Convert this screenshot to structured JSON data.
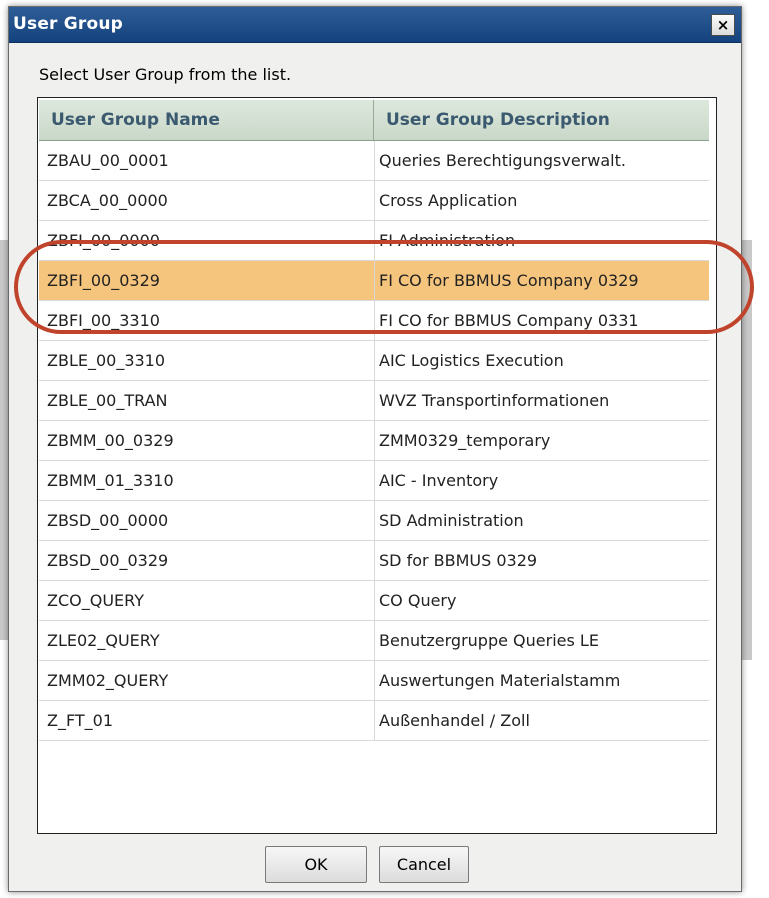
{
  "dialog": {
    "title": "User Group",
    "close_glyph": "×",
    "instruction": "Select User Group from the list."
  },
  "grid": {
    "columns": [
      "User Group Name",
      "User Group Description"
    ],
    "rows": [
      {
        "name": "ZBAU_00_0001",
        "description": "Queries Berechtigungsverwalt."
      },
      {
        "name": "ZBCA_00_0000",
        "description": "Cross Application"
      },
      {
        "name": "ZBFI_00_0000",
        "description": "FI Administration"
      },
      {
        "name": "ZBFI_00_0329",
        "description": "FI CO  for BBMUS  Company 0329"
      },
      {
        "name": "ZBFI_00_3310",
        "description": "FI CO  for BBMUS  Company 0331"
      },
      {
        "name": "ZBLE_00_3310",
        "description": "AIC Logistics Execution"
      },
      {
        "name": "ZBLE_00_TRAN",
        "description": "WVZ Transportinformationen"
      },
      {
        "name": "ZBMM_00_0329",
        "description": "ZMM0329_temporary"
      },
      {
        "name": "ZBMM_01_3310",
        "description": "AIC - Inventory"
      },
      {
        "name": "ZBSD_00_0000",
        "description": "SD Administration"
      },
      {
        "name": "ZBSD_00_0329",
        "description": "SD for BBMUS 0329"
      },
      {
        "name": "ZCO_QUERY",
        "description": "CO Query"
      },
      {
        "name": "ZLE02_QUERY",
        "description": "Benutzergruppe Queries LE"
      },
      {
        "name": "ZMM02_QUERY",
        "description": "Auswertungen Materialstamm"
      },
      {
        "name": "Z_FT_01",
        "description": "Außenhandel / Zoll"
      }
    ],
    "selected_row_index": 3
  },
  "buttons": {
    "ok_label": "OK",
    "cancel_label": "Cancel"
  },
  "colors": {
    "title_bar": "#1d4a85",
    "header_text": "#3b5a6f",
    "selected_row": "#f6c57d",
    "annotation_ring": "#c0432b"
  }
}
